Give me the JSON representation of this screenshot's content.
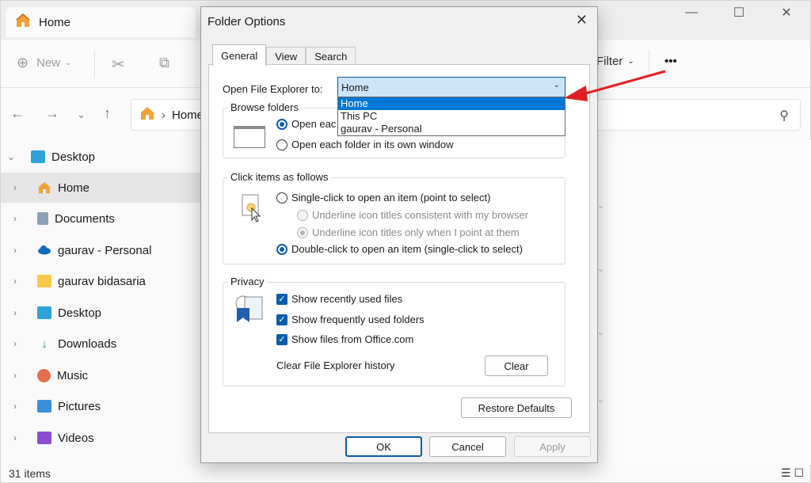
{
  "explorer": {
    "tab_title": "Home",
    "toolbar": {
      "new_label": "New",
      "filter_label": "Filter",
      "more_label": "•••"
    },
    "address": {
      "crumb": "Home"
    },
    "sidebar": {
      "items": [
        {
          "label": "Desktop",
          "icon": "desktop-icon",
          "expanded": true
        },
        {
          "label": "Home",
          "icon": "home-icon",
          "selected": true
        },
        {
          "label": "Documents",
          "icon": "documents-icon"
        },
        {
          "label": "gaurav - Personal",
          "icon": "onedrive-icon"
        },
        {
          "label": "gaurav bidasaria",
          "icon": "folder-icon"
        },
        {
          "label": "Desktop",
          "icon": "desktop-icon"
        },
        {
          "label": "Downloads",
          "icon": "downloads-icon"
        },
        {
          "label": "Music",
          "icon": "music-icon"
        },
        {
          "label": "Pictures",
          "icon": "pictures-icon"
        },
        {
          "label": "Videos",
          "icon": "videos-icon"
        }
      ]
    },
    "status": {
      "items_count": "31 items"
    }
  },
  "dialog": {
    "title": "Folder Options",
    "tabs": [
      "General",
      "View",
      "Search"
    ],
    "active_tab": "General",
    "open_explorer_label": "Open File Explorer to:",
    "open_explorer_value": "Home",
    "dropdown_options": [
      "Home",
      "This PC",
      "gaurav - Personal"
    ],
    "browse_folders": {
      "title": "Browse folders",
      "option_same": "Open eac",
      "option_own": "Open each folder in its own window"
    },
    "click_items": {
      "title": "Click items as follows",
      "single": "Single-click to open an item (point to select)",
      "underline_browser": "Underline icon titles consistent with my browser",
      "underline_point": "Underline icon titles only when I point at them",
      "double": "Double-click to open an item (single-click to select)"
    },
    "privacy": {
      "title": "Privacy",
      "recent_files": "Show recently used files",
      "frequent_folders": "Show frequently used folders",
      "office_files": "Show files from Office.com",
      "clear_history_label": "Clear File Explorer history",
      "clear_button": "Clear"
    },
    "restore_defaults": "Restore Defaults",
    "ok": "OK",
    "cancel": "Cancel",
    "apply": "Apply"
  },
  "colors": {
    "accent": "#0b5cad",
    "highlight": "#0078d7",
    "combo_bg": "#cce4f7",
    "arrow": "#e02020"
  }
}
